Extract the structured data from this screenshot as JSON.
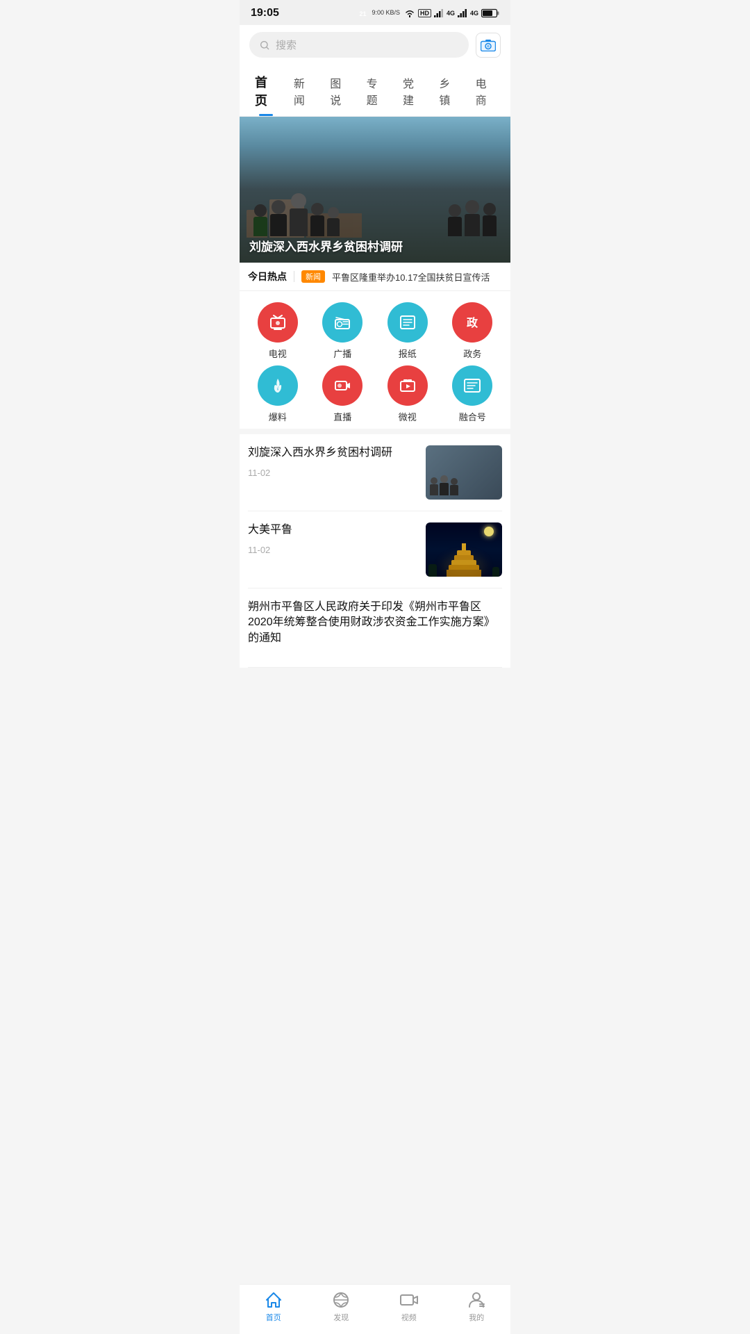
{
  "statusBar": {
    "time": "19:05",
    "network": "9:00 KB/S",
    "wifi": "WiFi",
    "signal1": "HD",
    "signal2": "4G",
    "signal3": "4G",
    "battery": "21"
  },
  "search": {
    "placeholder": "搜索",
    "cameraLabel": "camera"
  },
  "navTabs": [
    {
      "label": "首页",
      "active": true
    },
    {
      "label": "新闻",
      "active": false
    },
    {
      "label": "图说",
      "active": false
    },
    {
      "label": "专题",
      "active": false
    },
    {
      "label": "党建",
      "active": false
    },
    {
      "label": "乡镇",
      "active": false
    },
    {
      "label": "电商",
      "active": false
    }
  ],
  "heroBanner": {
    "title": "刘旋深入西水界乡贫困村调研"
  },
  "hotStrip": {
    "label": "今日热点",
    "badge": "新闻",
    "text": "平鲁区隆重举办10.17全国扶贫日宣传活"
  },
  "iconGrid": [
    {
      "label": "电视",
      "icon": "tv",
      "color": "red"
    },
    {
      "label": "广播",
      "icon": "radio",
      "color": "cyan"
    },
    {
      "label": "报纸",
      "icon": "newspaper",
      "color": "cyan"
    },
    {
      "label": "政务",
      "icon": "gov",
      "color": "red"
    },
    {
      "label": "爆料",
      "icon": "fire",
      "color": "cyan"
    },
    {
      "label": "直播",
      "icon": "live",
      "color": "red"
    },
    {
      "label": "微视",
      "icon": "video",
      "color": "red"
    },
    {
      "label": "融合号",
      "icon": "merge",
      "color": "cyan"
    }
  ],
  "newsList": [
    {
      "title": "刘旋深入西水界乡贫困村调研",
      "date": "11-02",
      "hasThumb": true,
      "thumbType": "people"
    },
    {
      "title": "大美平鲁",
      "date": "11-02",
      "hasThumb": true,
      "thumbType": "tower"
    },
    {
      "title": "朔州市平鲁区人民政府关于印发《朔州市平鲁区2020年统筹整合使用财政涉农资金工作实施方案》的通知",
      "date": "",
      "hasThumb": false,
      "thumbType": "none"
    }
  ],
  "bottomNav": [
    {
      "label": "首页",
      "icon": "home",
      "active": true
    },
    {
      "label": "发现",
      "icon": "discover",
      "active": false
    },
    {
      "label": "视频",
      "icon": "video",
      "active": false
    },
    {
      "label": "我的",
      "icon": "user",
      "active": false
    }
  ]
}
